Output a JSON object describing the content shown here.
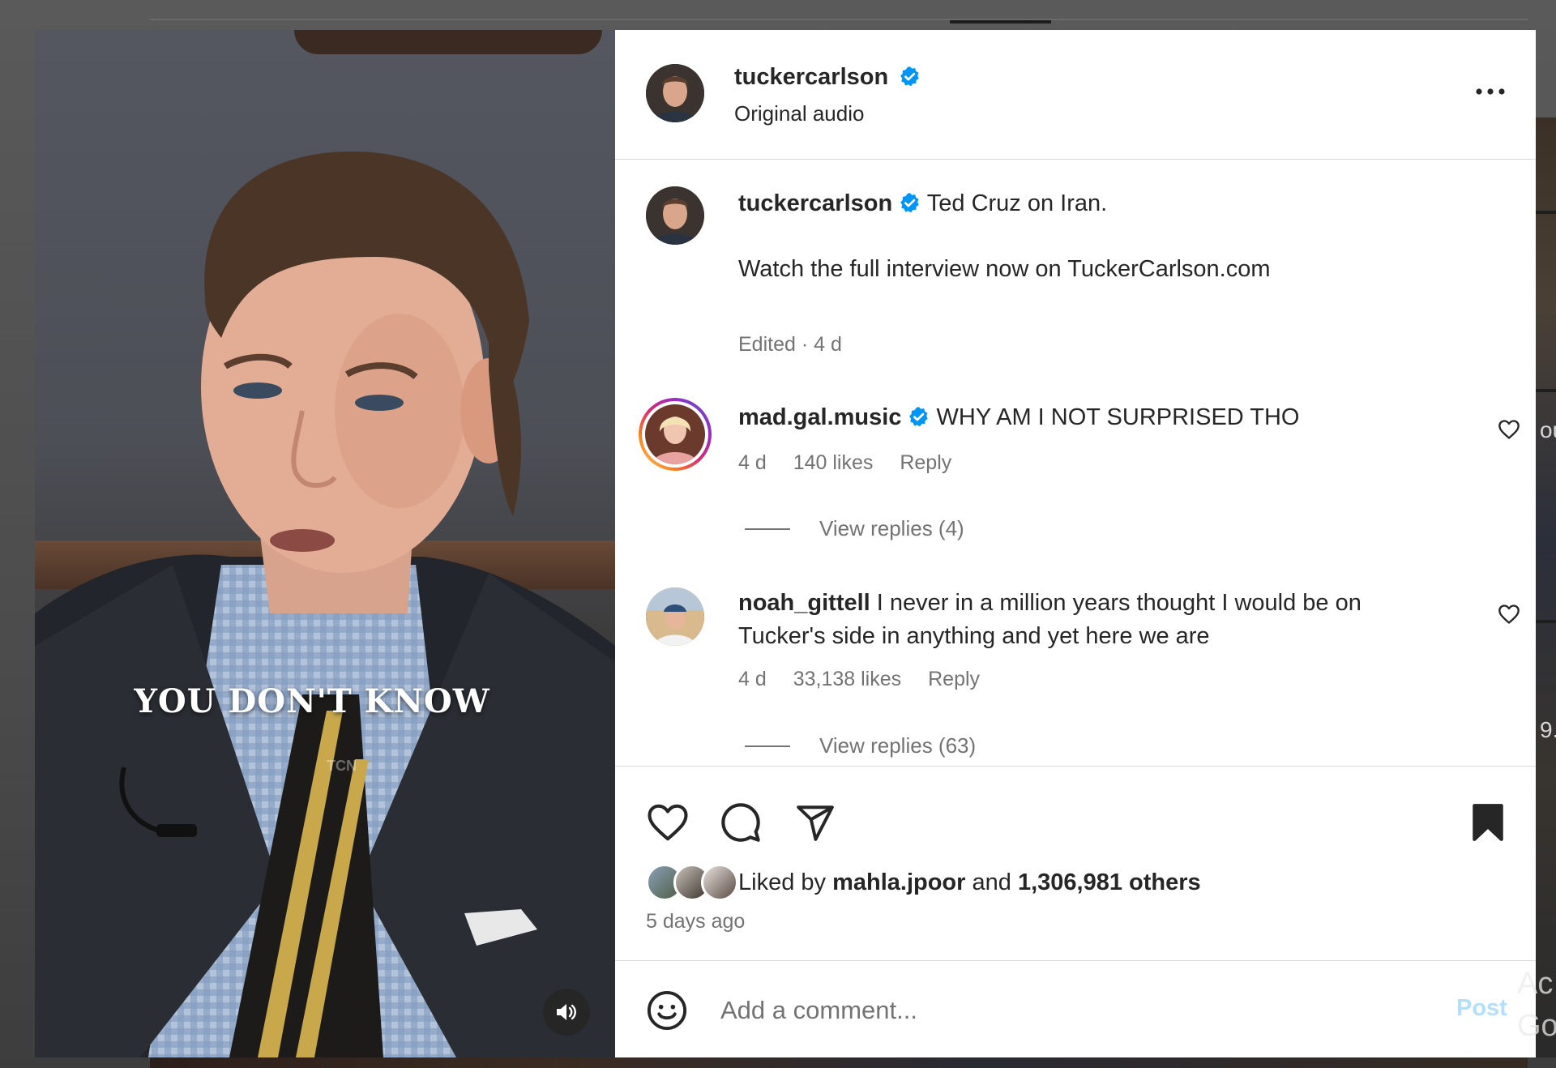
{
  "post": {
    "author": "tuckercarlson",
    "audio_label": "Original audio",
    "video_caption": "YOU DON'T KNOW",
    "video_watermark": "TCN",
    "caption_text": "Ted Cruz on Iran.",
    "caption_line2": "Watch the full interview now on TuckerCarlson.com",
    "caption_meta": "Edited · 4 d",
    "liked_by_prefix": "Liked by",
    "liked_by_user": "mahla.jpoor",
    "liked_by_and": "and",
    "liked_by_others": "1,306,981 others",
    "posted_ago": "5 days ago"
  },
  "comments": [
    {
      "user": "mad.gal.music",
      "verified": true,
      "text": "WHY AM I NOT SURPRISED THO",
      "age": "4 d",
      "likes": "140 likes",
      "reply_label": "Reply",
      "view_replies": "View replies (4)"
    },
    {
      "user": "noah_gittell",
      "verified": false,
      "text_line1": "I never in a million years thought I would be on",
      "text_line2": "Tucker's side in anything and yet here we are",
      "age": "4 d",
      "likes": "33,138 likes",
      "reply_label": "Reply",
      "view_replies": "View replies (63)"
    }
  ],
  "comment_box": {
    "placeholder": "Add a comment...",
    "post_label": "Post"
  },
  "icons": {
    "verified": "verified-badge-icon",
    "more": "more-options-icon",
    "like": "heart-icon",
    "comment": "comment-icon",
    "share": "share-icon",
    "save": "bookmark-icon",
    "emoji": "emoji-icon",
    "audio": "speaker-icon"
  },
  "colors": {
    "verified_blue": "#0095f6",
    "text_primary": "#262626",
    "text_secondary": "#737373",
    "post_disabled": "#b2dffc",
    "divider": "#dbdbdb"
  },
  "background": {
    "watermark_line1": "Ac",
    "watermark_line2": "Go",
    "right_edge_text1": "ou",
    "right_edge_text2": "9."
  }
}
